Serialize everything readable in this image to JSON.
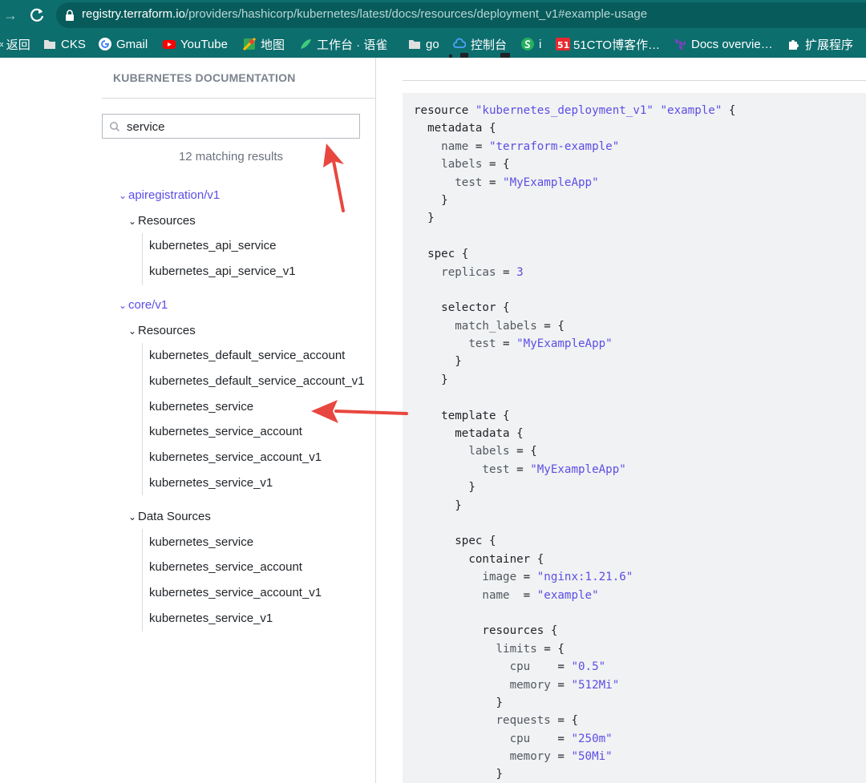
{
  "browser": {
    "url_host": "registry.terraform.io",
    "url_path": "/providers/hashicorp/kubernetes/latest/docs/resources/deployment_v1#example-usage",
    "bookmarks": [
      {
        "label": "返回",
        "icon": "chevron-double-left-icon"
      },
      {
        "label": "CKS",
        "icon": "folder-icon"
      },
      {
        "label": "Gmail",
        "icon": "google-icon"
      },
      {
        "label": "YouTube",
        "icon": "youtube-icon"
      },
      {
        "label": "地图",
        "icon": "maps-icon"
      },
      {
        "label": "工作台 · 语雀",
        "icon": "yuque-icon"
      },
      {
        "label": "go",
        "icon": "folder-icon"
      },
      {
        "label": "控制台",
        "icon": "cloud-icon"
      },
      {
        "label": "i",
        "icon": "s-logo-icon"
      },
      {
        "label": "51CTO博客作…",
        "icon": "51cto-icon"
      },
      {
        "label": "Docs overvie…",
        "icon": "terraform-icon"
      },
      {
        "label": "扩展程序",
        "icon": "puzzle-icon"
      }
    ]
  },
  "sidebar": {
    "title": "KUBERNETES DOCUMENTATION",
    "search": {
      "value": "service"
    },
    "match_count": "12 matching results",
    "groups": [
      {
        "label": "apiregistration/v1",
        "sections": [
          {
            "label": "Resources",
            "items": [
              "kubernetes_api_service",
              "kubernetes_api_service_v1"
            ]
          }
        ]
      },
      {
        "label": "core/v1",
        "sections": [
          {
            "label": "Resources",
            "items": [
              "kubernetes_default_service_account",
              "kubernetes_default_service_account_v1",
              "kubernetes_service",
              "kubernetes_service_account",
              "kubernetes_service_account_v1",
              "kubernetes_service_v1"
            ]
          },
          {
            "label": "Data Sources",
            "items": [
              "kubernetes_service",
              "kubernetes_service_account",
              "kubernetes_service_account_v1",
              "kubernetes_service_v1"
            ]
          }
        ]
      }
    ]
  },
  "code": {
    "lines": [
      [
        [
          "kw",
          "resource "
        ],
        [
          "str",
          "\"kubernetes_deployment_v1\""
        ],
        [
          "kw",
          " "
        ],
        [
          "str",
          "\"example\""
        ],
        [
          "kw",
          " {"
        ]
      ],
      [
        [
          "kw",
          "  metadata {"
        ]
      ],
      [
        [
          "attr",
          "    name"
        ],
        [
          "kw",
          " = "
        ],
        [
          "str",
          "\"terraform-example\""
        ]
      ],
      [
        [
          "attr",
          "    labels"
        ],
        [
          "kw",
          " = {"
        ]
      ],
      [
        [
          "attr",
          "      test"
        ],
        [
          "kw",
          " = "
        ],
        [
          "str",
          "\"MyExampleApp\""
        ]
      ],
      [
        [
          "kw",
          "    }"
        ]
      ],
      [
        [
          "kw",
          "  }"
        ]
      ],
      [
        [
          "kw",
          ""
        ]
      ],
      [
        [
          "kw",
          "  spec {"
        ]
      ],
      [
        [
          "attr",
          "    replicas"
        ],
        [
          "kw",
          " = "
        ],
        [
          "num",
          "3"
        ]
      ],
      [
        [
          "kw",
          ""
        ]
      ],
      [
        [
          "kw",
          "    selector {"
        ]
      ],
      [
        [
          "attr",
          "      match_labels"
        ],
        [
          "kw",
          " = {"
        ]
      ],
      [
        [
          "attr",
          "        test"
        ],
        [
          "kw",
          " = "
        ],
        [
          "str",
          "\"MyExampleApp\""
        ]
      ],
      [
        [
          "kw",
          "      }"
        ]
      ],
      [
        [
          "kw",
          "    }"
        ]
      ],
      [
        [
          "kw",
          ""
        ]
      ],
      [
        [
          "kw",
          "    template {"
        ]
      ],
      [
        [
          "kw",
          "      metadata {"
        ]
      ],
      [
        [
          "attr",
          "        labels"
        ],
        [
          "kw",
          " = {"
        ]
      ],
      [
        [
          "attr",
          "          test"
        ],
        [
          "kw",
          " = "
        ],
        [
          "str",
          "\"MyExampleApp\""
        ]
      ],
      [
        [
          "kw",
          "        }"
        ]
      ],
      [
        [
          "kw",
          "      }"
        ]
      ],
      [
        [
          "kw",
          ""
        ]
      ],
      [
        [
          "kw",
          "      spec {"
        ]
      ],
      [
        [
          "kw",
          "        container {"
        ]
      ],
      [
        [
          "attr",
          "          image"
        ],
        [
          "kw",
          " = "
        ],
        [
          "str",
          "\"nginx:1.21.6\""
        ]
      ],
      [
        [
          "attr",
          "          name"
        ],
        [
          "kw",
          "  = "
        ],
        [
          "str",
          "\"example\""
        ]
      ],
      [
        [
          "kw",
          ""
        ]
      ],
      [
        [
          "kw",
          "          resources {"
        ]
      ],
      [
        [
          "attr",
          "            limits"
        ],
        [
          "kw",
          " = {"
        ]
      ],
      [
        [
          "attr",
          "              cpu"
        ],
        [
          "kw",
          "    = "
        ],
        [
          "str",
          "\"0.5\""
        ]
      ],
      [
        [
          "attr",
          "              memory"
        ],
        [
          "kw",
          " = "
        ],
        [
          "str",
          "\"512Mi\""
        ]
      ],
      [
        [
          "kw",
          "            }"
        ]
      ],
      [
        [
          "attr",
          "            requests"
        ],
        [
          "kw",
          " = {"
        ]
      ],
      [
        [
          "attr",
          "              cpu"
        ],
        [
          "kw",
          "    = "
        ],
        [
          "str",
          "\"250m\""
        ]
      ],
      [
        [
          "attr",
          "              memory"
        ],
        [
          "kw",
          " = "
        ],
        [
          "str",
          "\"50Mi\""
        ]
      ],
      [
        [
          "kw",
          "            }"
        ]
      ]
    ]
  },
  "colors": {
    "chrome": "#0d6e6e",
    "link": "#5c4ee5",
    "annotation_arrow": "#e8473f"
  }
}
